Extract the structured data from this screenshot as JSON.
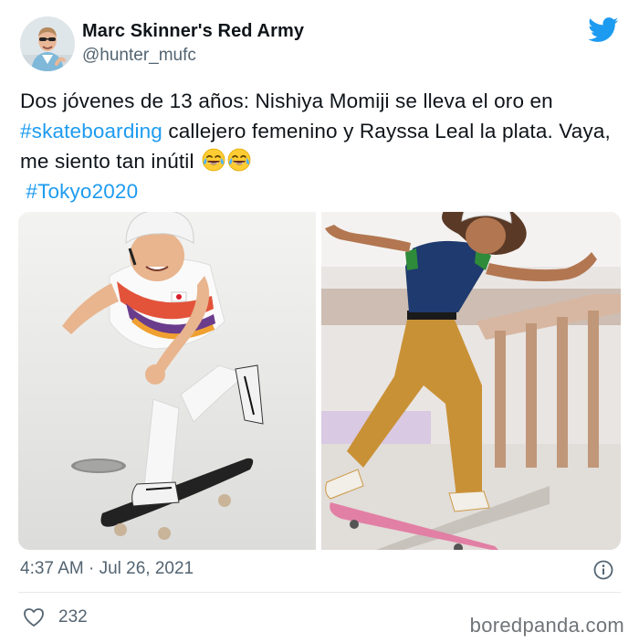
{
  "author": {
    "display_name": "Marc Skinner's Red Army",
    "handle": "@hunter_mufc"
  },
  "tweet": {
    "text_1": "Dos jóvenes de 13 años: Nishiya Momiji se lleva el oro en ",
    "hashtag_1": "#skateboarding",
    "text_2": " callejero femenino y Rayssa Leal la plata. Vaya, me siento tan inútil ",
    "emoji": "face-with-tears-of-joy",
    "hashtag_2": "#Tokyo2020"
  },
  "media": [
    {
      "name": "skater-photo-nishiya"
    },
    {
      "name": "skater-photo-rayssa"
    }
  ],
  "meta": {
    "timestamp": "4:37 AM · Jul 26, 2021",
    "likes": "232"
  },
  "watermark": "boredpanda.com",
  "colors": {
    "link": "#1d9bf0",
    "secondary_text": "#536471",
    "twitter_blue": "#1d9bf0"
  },
  "icons": [
    "twitter-bird-icon",
    "info-icon",
    "heart-icon"
  ]
}
